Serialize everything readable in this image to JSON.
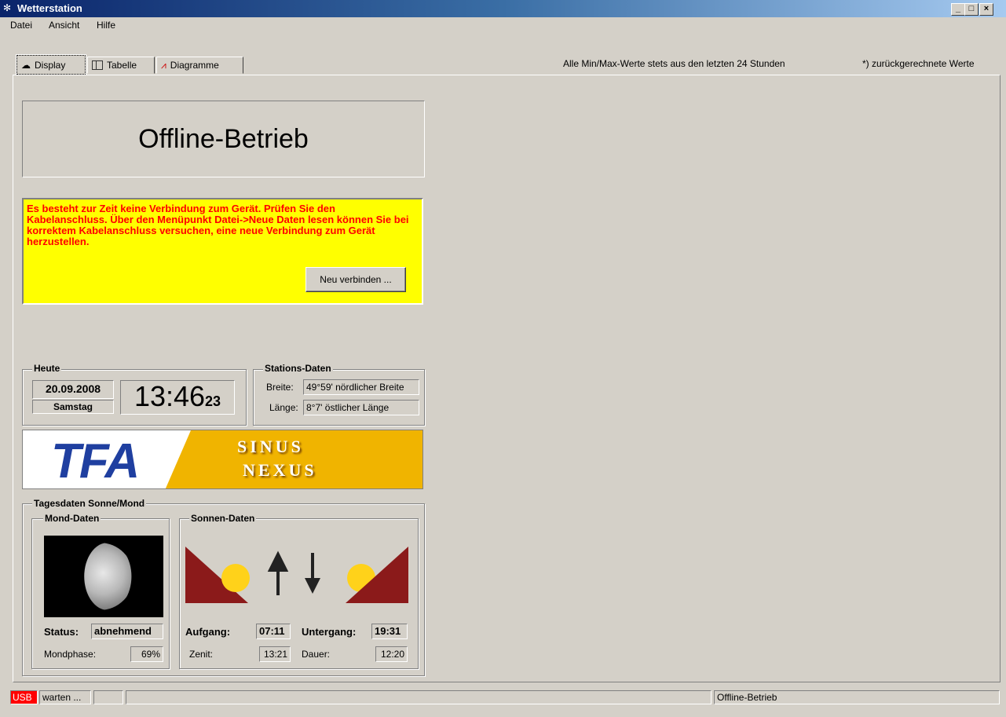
{
  "window": {
    "title": "Wetterstation",
    "title_icon": "paw-icon"
  },
  "menu": {
    "items": [
      "Datei",
      "Ansicht",
      "Hilfe"
    ]
  },
  "tabs": [
    {
      "label": "Display",
      "icon": "display-icon",
      "active": true
    },
    {
      "label": "Tabelle",
      "icon": "table-icon",
      "active": false
    },
    {
      "label": "Diagramme",
      "icon": "chart-icon",
      "active": false
    }
  ],
  "info": {
    "minmax_note": "Alle Min/Max-Werte stets aus den letzten 24 Stunden",
    "calc_note": "*) zurückgerechnete Werte"
  },
  "status_banner": "Offline-Betrieb",
  "warning": {
    "text": "Es besteht zur Zeit keine Verbindung zum Gerät. Prüfen Sie den Kabelanschluss. Über den Menüpunkt Datei->Neue Daten lesen können Sie bei korrektem Kabelanschluss versuchen, eine neue Verbindung zum Gerät herzustellen.",
    "button": "Neu verbinden ...",
    "bg_color": "#ffff00",
    "text_color": "#ff0000"
  },
  "today": {
    "label": "Heute",
    "date": "20.09.2008",
    "weekday": "Samstag",
    "time": "13:46",
    "seconds": "23"
  },
  "station": {
    "label": "Stations-Daten",
    "lat_label": "Breite:",
    "lat_value": "49°59' nördlicher Breite",
    "lon_label": "Länge:",
    "lon_value": "8°7' östlicher Länge"
  },
  "banner": {
    "logo": "TFA",
    "line1": "SINUS",
    "line2": "NEXUS",
    "bg_color": "#f0b400"
  },
  "sunmoon": {
    "label": "Tagesdaten Sonne/Mond",
    "moon": {
      "label": "Mond-Daten",
      "status_label": "Status:",
      "status_value": "abnehmend",
      "phase_label": "Mondphase:",
      "phase_value": "69%"
    },
    "sun": {
      "label": "Sonnen-Daten",
      "rise_label": "Aufgang:",
      "rise_value": "07:11",
      "set_label": "Untergang:",
      "set_value": "19:31",
      "zenith_label": "Zenit:",
      "zenith_value": "13:21",
      "duration_label": "Dauer:",
      "duration_value": "12:20"
    }
  },
  "statusbar": {
    "usb": "USB",
    "state": "warten ...",
    "mode": "Offline-Betrieb"
  }
}
